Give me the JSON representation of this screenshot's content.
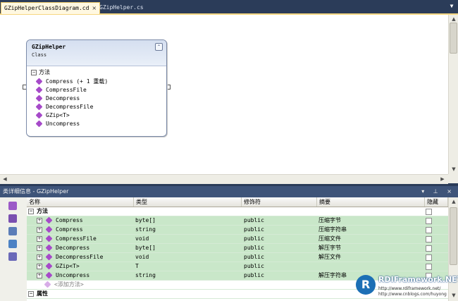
{
  "tabs": [
    {
      "label": "GZipHelperClassDiagram.cd",
      "close": "×",
      "active": true
    },
    {
      "label": "GZipHelper.cs",
      "active": false
    }
  ],
  "tab_dropdown": "▼",
  "class_shape": {
    "name": "GZipHelper",
    "kind": "Class",
    "collapse_glyph": "⌃",
    "section": {
      "toggle": "−",
      "label": "方法"
    },
    "members": [
      "Compress (+ 1 重载)",
      "CompressFile",
      "Decompress",
      "DecompressFile",
      "GZip<T>",
      "Uncompress"
    ]
  },
  "details": {
    "title": "类详细信息 - GZipHelper",
    "title_buttons": "▾ ⊥ ×",
    "columns": [
      "名称",
      "类型",
      "修饰符",
      "摘要",
      "隐藏"
    ],
    "groups": {
      "methods": "方法",
      "properties": "属性"
    },
    "rows": [
      {
        "name": "Compress",
        "type": "byte[]",
        "modifier": "public",
        "summary": "压缩字节"
      },
      {
        "name": "Compress",
        "type": "string",
        "modifier": "public",
        "summary": "压缩字符串"
      },
      {
        "name": "CompressFile",
        "type": "void",
        "modifier": "public",
        "summary": "压缩文件"
      },
      {
        "name": "Decompress",
        "type": "byte[]",
        "modifier": "public",
        "summary": "解压字节"
      },
      {
        "name": "DecompressFile",
        "type": "void",
        "modifier": "public",
        "summary": "解压文件"
      },
      {
        "name": "GZip<T>",
        "type": "T",
        "modifier": "public",
        "summary": ""
      },
      {
        "name": "Uncompress",
        "type": "string",
        "modifier": "public",
        "summary": "解压字符串"
      }
    ],
    "add_method": "<添加方法>",
    "expand_plus": "+",
    "expand_minus": "−"
  },
  "watermark": {
    "logo": "R",
    "name": "RDIFramework.NET",
    "url1": "http://www.rdiframework.net/",
    "url2": "http://www.cnblogs.com/huyong"
  },
  "colors": {
    "member_row": "#c9e7c9",
    "method_icon": "#a64ac9",
    "panel_title": "#3e5479"
  }
}
